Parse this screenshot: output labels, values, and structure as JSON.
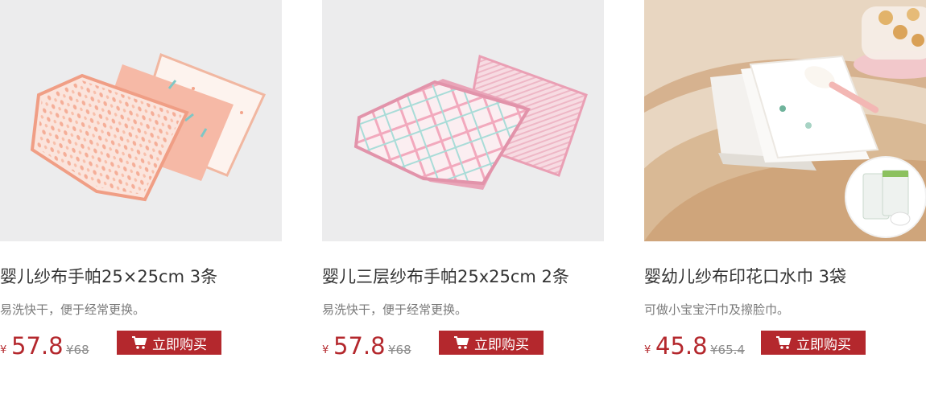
{
  "products": [
    {
      "title": "婴儿纱布手帕25×25cm  3条",
      "desc": "易洗快干，便于经常更换。",
      "currency": "¥",
      "price": "57.8",
      "orig_price": "¥68",
      "buy_label": "立即购买",
      "image_icon": "pink-gauze-handkerchiefs-image"
    },
    {
      "title": "婴儿三层纱布手帕25x25cm  2条",
      "desc": "易洗快干，便于经常更换。",
      "currency": "¥",
      "price": "57.8",
      "orig_price": "¥68",
      "buy_label": "立即购买",
      "image_icon": "plaid-gauze-handkerchiefs-image"
    },
    {
      "title": "婴幼儿纱布印花口水巾 3袋",
      "desc": "可做小宝宝汗巾及擦脸巾。",
      "currency": "¥",
      "price": "45.8",
      "orig_price": "¥65.4",
      "buy_label": "立即购买",
      "image_icon": "printed-drool-towel-image"
    }
  ],
  "colors": {
    "accent": "#b4282d",
    "thumb_bg": "#ececed",
    "desc_text": "#7a7a7a",
    "orig_price": "#8c8c8c"
  },
  "icons": {
    "buy": "cart-icon"
  }
}
